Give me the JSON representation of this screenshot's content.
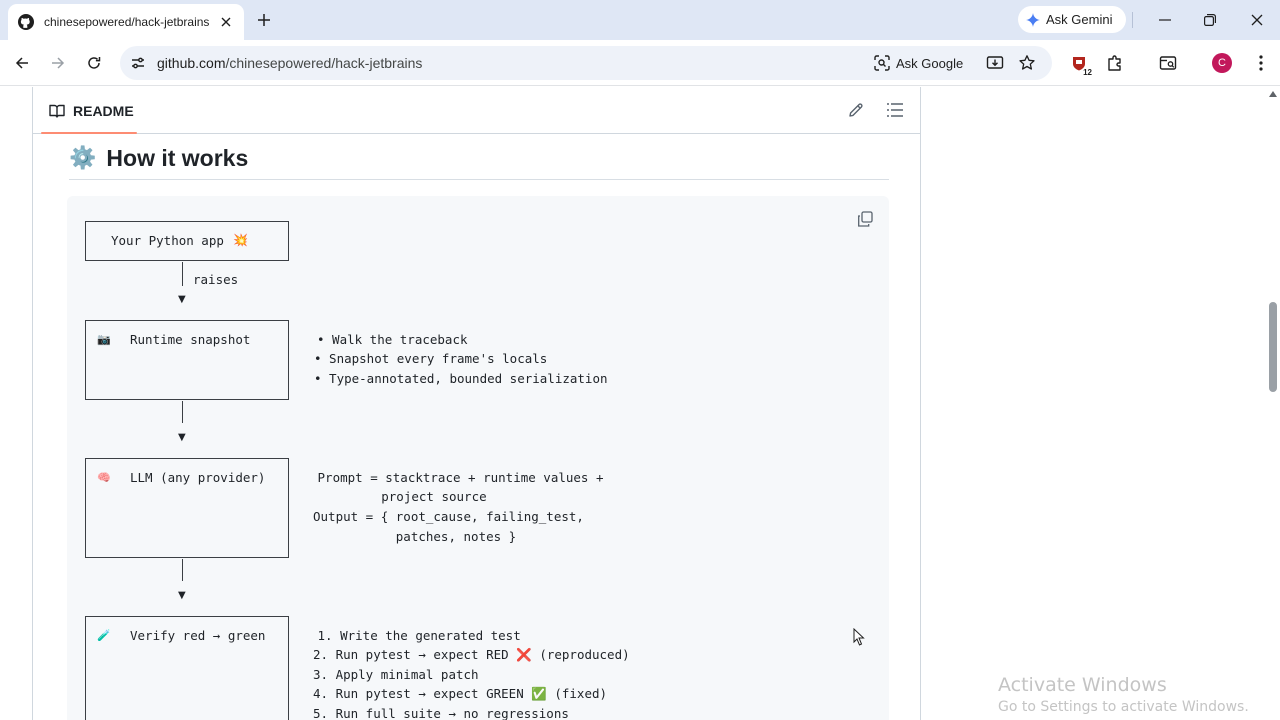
{
  "browser": {
    "tab_title": "chinesepowered/hack-jetbrains",
    "ask_gemini": "Ask Gemini",
    "url_host": "github.com",
    "url_path": "/chinesepowered/hack-jetbrains",
    "ask_google": "Ask Google",
    "extensions_badge": "12",
    "profile_initial": "C"
  },
  "readme": {
    "tab_label": "README",
    "heading_emoji": "⚙️",
    "heading": "How it works"
  },
  "diagram": {
    "box1_label": "Your Python app",
    "box1_emoji": "💥",
    "edge1_label": "raises",
    "box2_emoji": "📷",
    "box2_label": "Runtime snapshot",
    "box2_notes": [
      "• Walk the traceback",
      "• Snapshot every frame's locals",
      "• Type-annotated, bounded serialization"
    ],
    "box3_emoji": "🧠",
    "box3_label": "LLM (any provider)",
    "box3_notes": [
      " Prompt = stacktrace + runtime values +",
      "          project source",
      "Output = { root_cause, failing_test,",
      "           patches, notes }"
    ],
    "box4_emoji": "🧪",
    "box4_label": "Verify red → green",
    "box4_steps": [
      " 1. Write the generated test",
      "2. Run pytest → expect RED",
      "3. Apply minimal patch",
      "4. Run pytest → expect GREEN",
      "5. Run full suite → no regressions"
    ],
    "step2_mark": "❌",
    "step2_suffix": "(reproduced)",
    "step4_mark": "✅",
    "step4_suffix": "(fixed)"
  },
  "watermark": {
    "line1": "Activate Windows",
    "line2": "Go to Settings to activate Windows."
  }
}
